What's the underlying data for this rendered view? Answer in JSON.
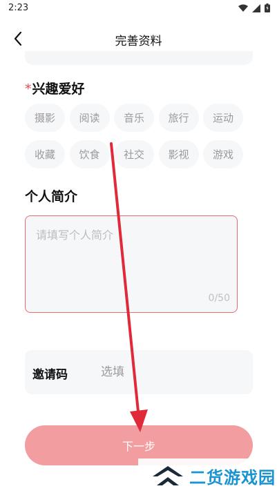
{
  "status": {
    "time": "2:23"
  },
  "header": {
    "title": "完善资料"
  },
  "hobbies": {
    "required_mark": "*",
    "title": "兴趣爱好",
    "tags": [
      "摄影",
      "阅读",
      "音乐",
      "旅行",
      "运动",
      "收藏",
      "饮食",
      "社交",
      "影视",
      "游戏"
    ]
  },
  "intro": {
    "title": "个人简介",
    "placeholder": "请填写个人简介",
    "count": "0/50"
  },
  "invite": {
    "label": "邀请码",
    "placeholder": "选填"
  },
  "footer": {
    "next_label": "下一步"
  },
  "watermark": {
    "text": "二货游戏园"
  },
  "colors": {
    "accent": "#e8474f",
    "button": "#f29da0",
    "arrow": "#e02a3a",
    "field_bg": "#f6f7f9",
    "watermark": "#1a93d1"
  }
}
